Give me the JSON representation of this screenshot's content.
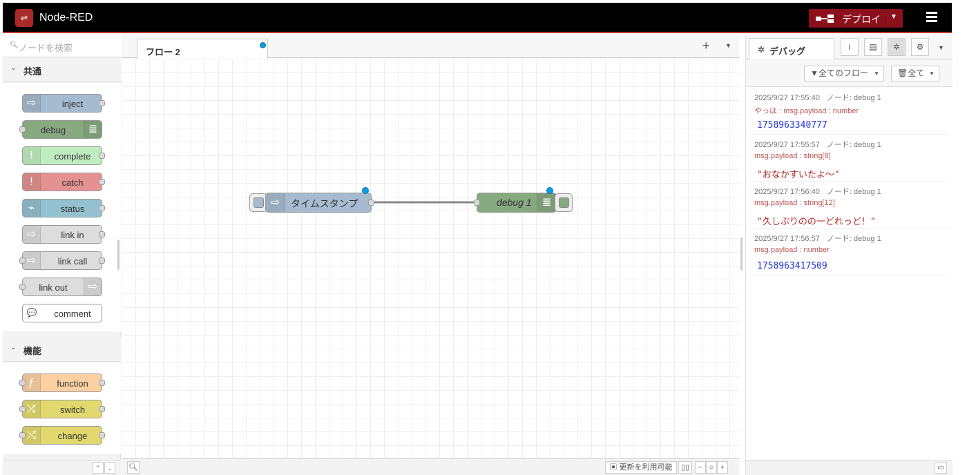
{
  "header": {
    "title": "Node-RED",
    "deploy_label": "デプロイ"
  },
  "palette": {
    "search_placeholder": "ノードを検索",
    "categories": [
      {
        "label": "共通",
        "nodes": [
          {
            "label": "inject",
            "color": "#a6bbcf",
            "icon": "⇨",
            "icon_side": "left",
            "input": false,
            "output": true
          },
          {
            "label": "debug",
            "color": "#87a980",
            "icon": "≣",
            "icon_side": "right",
            "input": true,
            "output": false
          },
          {
            "label": "complete",
            "color": "#c0edc0",
            "icon": "!",
            "icon_side": "left",
            "input": false,
            "output": true
          },
          {
            "label": "catch",
            "color": "#e49191",
            "icon": "!",
            "icon_side": "left",
            "input": false,
            "output": true
          },
          {
            "label": "status",
            "color": "#94c1d0",
            "icon": "⌁",
            "icon_side": "left",
            "input": false,
            "output": true
          },
          {
            "label": "link in",
            "color": "#dddddd",
            "icon": "⇨",
            "icon_side": "left",
            "input": false,
            "output": true
          },
          {
            "label": "link call",
            "color": "#dddddd",
            "icon": "⇨",
            "icon_side": "left",
            "input": true,
            "output": true
          },
          {
            "label": "link out",
            "color": "#dddddd",
            "icon": "⇨",
            "icon_side": "right",
            "input": true,
            "output": false
          },
          {
            "label": "comment",
            "color": "#ffffff",
            "icon": "💬",
            "icon_side": "left",
            "input": false,
            "output": false
          }
        ]
      },
      {
        "label": "機能",
        "nodes": [
          {
            "label": "function",
            "color": "#fdd0a2",
            "icon": "ƒ",
            "icon_side": "left",
            "input": true,
            "output": true
          },
          {
            "label": "switch",
            "color": "#e2d96e",
            "icon": "⤨",
            "icon_side": "left",
            "input": true,
            "output": true
          },
          {
            "label": "change",
            "color": "#e2d96e",
            "icon": "⤭",
            "icon_side": "left",
            "input": true,
            "output": true
          }
        ]
      }
    ]
  },
  "workspace": {
    "tab_label": "フロー 2",
    "footer_update_label": "更新を利用可能",
    "nodes": [
      {
        "label": "タイムスタンプ",
        "color": "#a6bbcf",
        "icon": "⇨"
      },
      {
        "label": "debug 1",
        "color": "#87a980",
        "icon": "≣"
      }
    ]
  },
  "sidebar": {
    "tab_label": "デバッグ",
    "filter_flows": "全てのフロー",
    "filter_all": "全て",
    "messages": [
      {
        "time": "2025/9/27 17:55:40",
        "node": "ノード: debug 1",
        "type": "やっほ : msg.payload : number",
        "value": "1758963340777",
        "kind": "num"
      },
      {
        "time": "2025/9/27 17:55:57",
        "node": "ノード: debug 1",
        "type": "msg.payload : string[8]",
        "value": "\"おなかすいたよ〜\"",
        "kind": "str"
      },
      {
        "time": "2025/9/27 17:56:40",
        "node": "ノード: debug 1",
        "type": "msg.payload : string[12]",
        "value": "\"久しぶりのの一どれっど！\"",
        "kind": "str"
      },
      {
        "time": "2025/9/27 17:56:57",
        "node": "ノード: debug 1",
        "type": "msg.payload : number",
        "value": "1758963417509",
        "kind": "num"
      }
    ]
  }
}
